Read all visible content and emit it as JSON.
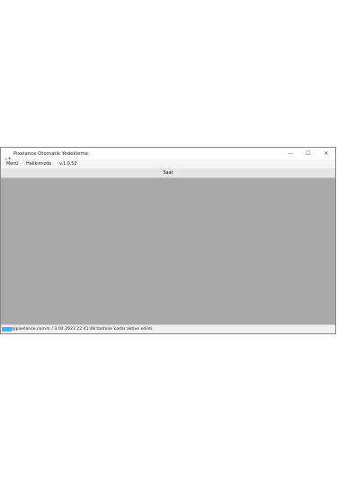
{
  "window": {
    "title": "Pixelance Otomatik Yedekleme",
    "icon": "pencil-icon",
    "controls": {
      "minimize": "—",
      "maximize": "☐",
      "close": "✕"
    }
  },
  "menubar": {
    "items": [
      {
        "label": "Menü"
      },
      {
        "label": "Hakkımızda"
      },
      {
        "label": "v.1.0.52"
      }
    ]
  },
  "button_row": {
    "label": "Saat"
  },
  "statusbar": {
    "text": "@pixelance.com.tr / 3.04.2023 22:41:48 tarihine kadar aktive edildi."
  },
  "colors": {
    "content_bg": "#a9a9a9",
    "status_highlight": "#3fb7e8"
  }
}
